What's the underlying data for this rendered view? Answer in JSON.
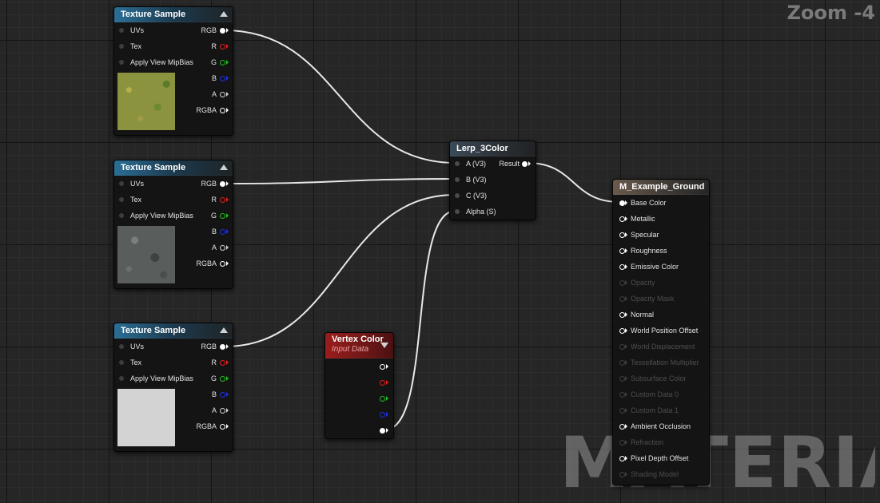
{
  "zoom_label": "Zoom -4",
  "watermark": "MATERIAL",
  "texture_nodes": [
    {
      "title": "Texture Sample",
      "inputs": [
        "UVs",
        "Tex",
        "Apply View MipBias"
      ],
      "outputs": [
        "RGB",
        "R",
        "G",
        "B",
        "A",
        "RGBA"
      ],
      "thumbnail": "grass"
    },
    {
      "title": "Texture Sample",
      "inputs": [
        "UVs",
        "Tex",
        "Apply View MipBias"
      ],
      "outputs": [
        "RGB",
        "R",
        "G",
        "B",
        "A",
        "RGBA"
      ],
      "thumbnail": "rock"
    },
    {
      "title": "Texture Sample",
      "inputs": [
        "UVs",
        "Tex",
        "Apply View MipBias"
      ],
      "outputs": [
        "RGB",
        "R",
        "G",
        "B",
        "A",
        "RGBA"
      ],
      "thumbnail": "white"
    }
  ],
  "lerp_node": {
    "title": "Lerp_3Color",
    "inputs": [
      "A (V3)",
      "B (V3)",
      "C (V3)",
      "Alpha (S)"
    ],
    "output": "Result"
  },
  "vertex_color_node": {
    "title": "Vertex Color",
    "subtitle": "Input Data",
    "output_channels": [
      "white",
      "red",
      "green",
      "blue",
      "alpha"
    ]
  },
  "material_node": {
    "title": "M_Example_Ground",
    "pins": [
      {
        "label": "Base Color",
        "enabled": true,
        "connected": true
      },
      {
        "label": "Metallic",
        "enabled": true
      },
      {
        "label": "Specular",
        "enabled": true
      },
      {
        "label": "Roughness",
        "enabled": true
      },
      {
        "label": "Emissive Color",
        "enabled": true
      },
      {
        "label": "Opacity",
        "enabled": false
      },
      {
        "label": "Opacity Mask",
        "enabled": false
      },
      {
        "label": "Normal",
        "enabled": true
      },
      {
        "label": "World Position Offset",
        "enabled": true
      },
      {
        "label": "World Displacement",
        "enabled": false
      },
      {
        "label": "Tessellation Multiplier",
        "enabled": false
      },
      {
        "label": "Subsurface Color",
        "enabled": false
      },
      {
        "label": "Custom Data 0",
        "enabled": false
      },
      {
        "label": "Custom Data 1",
        "enabled": false
      },
      {
        "label": "Ambient Occlusion",
        "enabled": true
      },
      {
        "label": "Refraction",
        "enabled": false
      },
      {
        "label": "Pixel Depth Offset",
        "enabled": true
      },
      {
        "label": "Shading Model",
        "enabled": false
      }
    ]
  },
  "pin_colors": {
    "RGB": "#ffffff",
    "R": "#e02020",
    "G": "#20c020",
    "B": "#2030e0",
    "A": "#d0d0d0",
    "RGBA": "#ffffff"
  },
  "wire_color": "#e8e8e8"
}
